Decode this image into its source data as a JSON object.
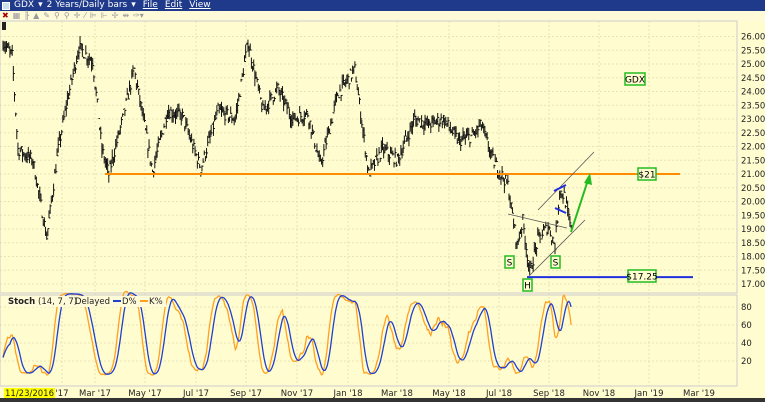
{
  "window": {
    "symbol": "GDX",
    "period": "2 Years/Daily bars",
    "menus": [
      "File",
      "Edit",
      "View"
    ]
  },
  "toolbar": {
    "icons": [
      "close-icon",
      "table-icon",
      "bar-chart-icon",
      "mountain-icon",
      "draw-icon",
      "zoom-in-icon",
      "zoom-out-icon",
      "crosshair-icon",
      "trendline-icon",
      "fib-icon",
      "fan-icon",
      "cursor-icon",
      "range-icon",
      "settings-icon"
    ]
  },
  "colors": {
    "background": "#fffdd0",
    "orange": "#ff8c00",
    "blue": "#2030e0",
    "green": "#22bb22",
    "k_line": "#ffa020",
    "d_line": "#2040d0"
  },
  "chart_data": {
    "type": "ohlc",
    "title": "GDX",
    "price_axis": {
      "ticks": [
        "26.00",
        "25.50",
        "25.00",
        "24.50",
        "24.00",
        "23.50",
        "23.00",
        "22.50",
        "22.00",
        "21.50",
        "21.00",
        "20.50",
        "20.00",
        "19.50",
        "19.00",
        "18.50",
        "18.00",
        "17.50",
        "17.00"
      ],
      "ylim": [
        16.75,
        26.6
      ]
    },
    "x_labels": [
      "11/23/2016",
      "'17",
      "Mar '17",
      "May '17",
      "Jul '17",
      "Sep '17",
      "Nov '17",
      "Jan '18",
      "Mar '18",
      "May '18",
      "Jul '18",
      "Sep '18",
      "Nov '18",
      "Jan '19",
      "Mar '19"
    ],
    "price_anchors": [
      [
        0,
        25.8
      ],
      [
        8,
        25.3
      ],
      [
        13,
        21.9
      ],
      [
        26,
        21.5
      ],
      [
        38,
        18.7
      ],
      [
        48,
        21.9
      ],
      [
        56,
        23.7
      ],
      [
        66,
        25.6
      ],
      [
        78,
        25.1
      ],
      [
        86,
        21.9
      ],
      [
        92,
        21.0
      ],
      [
        104,
        23.0
      ],
      [
        114,
        24.8
      ],
      [
        122,
        23.0
      ],
      [
        130,
        21.1
      ],
      [
        143,
        23.3
      ],
      [
        156,
        23.1
      ],
      [
        172,
        21.2
      ],
      [
        187,
        23.3
      ],
      [
        202,
        23.0
      ],
      [
        213,
        25.8
      ],
      [
        226,
        23.3
      ],
      [
        239,
        24.1
      ],
      [
        252,
        23.0
      ],
      [
        265,
        23.2
      ],
      [
        276,
        21.3
      ],
      [
        291,
        23.9
      ],
      [
        306,
        24.8
      ],
      [
        318,
        21.0
      ],
      [
        330,
        21.9
      ],
      [
        343,
        21.5
      ],
      [
        358,
        23.0
      ],
      [
        370,
        22.8
      ],
      [
        383,
        23.0
      ],
      [
        396,
        22.2
      ],
      [
        409,
        22.4
      ],
      [
        416,
        22.8
      ],
      [
        426,
        21.5
      ],
      [
        439,
        20.6
      ],
      [
        443,
        19.5
      ],
      [
        447,
        18.4
      ],
      [
        452,
        19.3
      ],
      [
        458,
        17.4
      ],
      [
        465,
        18.6
      ],
      [
        474,
        19.1
      ],
      [
        480,
        18.4
      ],
      [
        484,
        20.4
      ],
      [
        488,
        20.2
      ],
      [
        494,
        18.95
      ]
    ],
    "stoch": {
      "label": "Stoch",
      "params": "(14, 7, 7)",
      "mode": "Delayed",
      "series": [
        "D%",
        "K%"
      ],
      "ticks": [
        "80",
        "60",
        "40",
        "20"
      ],
      "ylim": [
        0,
        100
      ]
    },
    "annotations": {
      "ticker_box": "GDX",
      "resistance": {
        "label": "$21",
        "price": 21.0
      },
      "support": {
        "label": "$17.25",
        "price": 17.25
      },
      "pattern_labels": [
        "S",
        "H",
        "S"
      ]
    }
  }
}
